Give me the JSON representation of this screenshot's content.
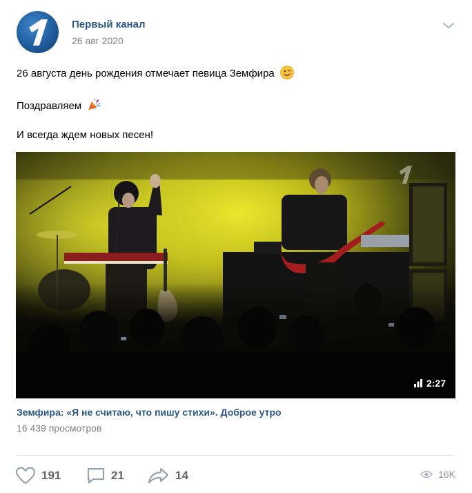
{
  "author": {
    "name": "Первый канал",
    "date": "26 авг 2020",
    "logo_glyph": "1"
  },
  "post_text": {
    "line1": "26 августа день рождения отмечает певица Земфира",
    "line2": "Поздравляем",
    "line3": "И всегда ждем новых песен!"
  },
  "emojis": {
    "line1": "winking-face-icon",
    "line2": "party-popper-icon"
  },
  "video": {
    "duration": "2:27",
    "title": "Земфира: «Я не считаю, что пишу стихи». Доброе утро",
    "views": "16 439 просмотров"
  },
  "actions": {
    "likes": "191",
    "comments": "21",
    "shares": "14",
    "views": "16K"
  },
  "colors": {
    "link": "#2a5885",
    "muted": "#828282",
    "icon": "#99a2ad",
    "brand": "#1c5a9c"
  }
}
